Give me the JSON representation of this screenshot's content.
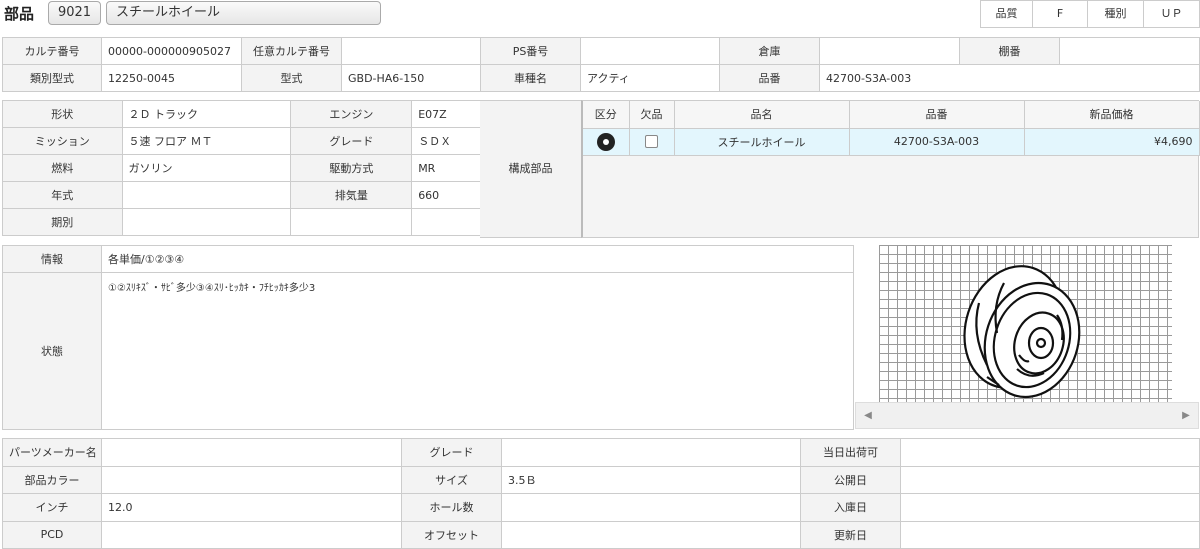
{
  "header": {
    "title": "部品",
    "code": "9021",
    "name": "スチールホイール",
    "quality_label": "品質",
    "quality_value": "F",
    "kind_label": "種別",
    "kind_value": "ＵＰ"
  },
  "row1": {
    "karte_no_label": "カルテ番号",
    "karte_no": "00000-000000905027",
    "opt_karte_label": "任意カルテ番号",
    "opt_karte": "",
    "ps_label": "PS番号",
    "ps": "",
    "warehouse_label": "倉庫",
    "warehouse": "",
    "shelf_label": "棚番",
    "shelf": ""
  },
  "row2": {
    "class_label": "類別型式",
    "class": "12250-0045",
    "model_label": "型式",
    "model": "GBD-HA6-150",
    "car_label": "車種名",
    "car": "アクティ",
    "partno_label": "品番",
    "partno": "42700-S3A-003"
  },
  "spec": {
    "shape_label": "形状",
    "shape": "２Ｄ トラック",
    "engine_label": "エンジン",
    "engine": "E07Z",
    "mission_label": "ミッション",
    "mission": "５速 フロア ＭＴ",
    "grade_label": "グレード",
    "grade": "ＳＤＸ",
    "fuel_label": "燃料",
    "fuel": "ガソリン",
    "drive_label": "駆動方式",
    "drive": "MR",
    "year_label": "年式",
    "year": "",
    "disp_label": "排気量",
    "disp": "660",
    "period_label": "期別",
    "period": "",
    "component_label": "構成部品"
  },
  "subparts": {
    "headers": [
      "区分",
      "欠品",
      "品名",
      "品番",
      "新品価格"
    ],
    "rows": [
      {
        "name": "スチールホイール",
        "partno": "42700-S3A-003",
        "price": "¥4,690"
      }
    ]
  },
  "info": {
    "info_label": "情報",
    "info": "各単価/①②③④",
    "status_label": "状態",
    "status": "①②ｽﾘｷｽﾞ・ｻﾋﾞ多少③④ｽﾘ･ﾋｯｶｷ・ﾌﾁﾋｯｶｷ多少3"
  },
  "details": {
    "maker_label": "パーツメーカー名",
    "maker": "",
    "grade_label": "グレード",
    "grade": "",
    "sameday_label": "当日出荷可",
    "sameday": "",
    "color_label": "部品カラー",
    "color": "",
    "size_label": "サイズ",
    "size": "3.5Ｂ",
    "publish_label": "公開日",
    "publish": "",
    "inch_label": "インチ",
    "inch": "12.0",
    "holes_label": "ホール数",
    "holes": "",
    "stock_label": "入庫日",
    "stock": "",
    "pcd_label": "PCD",
    "pcd": "",
    "offset_label": "オフセット",
    "offset": "",
    "update_label": "更新日",
    "update": ""
  },
  "icons": {
    "prev": "chevron-left-icon",
    "next": "chevron-right-icon",
    "category": "disc-icon"
  }
}
